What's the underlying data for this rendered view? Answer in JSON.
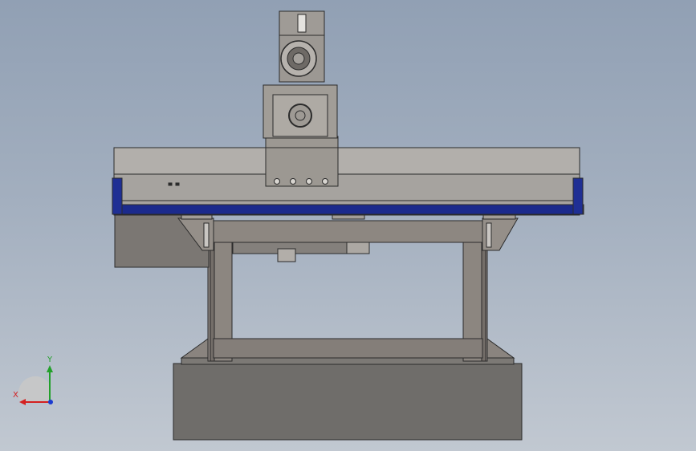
{
  "viewport": {
    "background_top": "#91a0b4",
    "background_bottom": "#c1c8d1"
  },
  "model": {
    "steel_color": "#9a9690",
    "frame_color": "#7f7872",
    "base_color": "#6f6d6a",
    "rail_accent_color": "#1b2a8c",
    "edge_color": "#2b2b2b"
  },
  "triad": {
    "x_label": "X",
    "y_label": "Y",
    "x_color": "#d42020",
    "y_color": "#22a02a",
    "z_color": "#1a3ad0"
  }
}
